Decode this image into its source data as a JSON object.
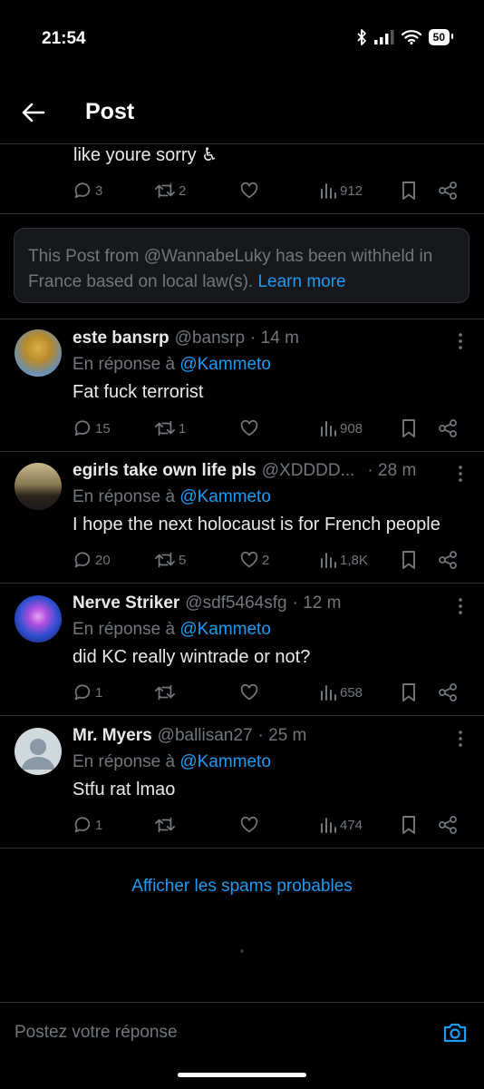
{
  "status_bar": {
    "time": "21:54",
    "battery": "50"
  },
  "header": {
    "title": "Post"
  },
  "previous_post": {
    "text_tail": "like youre sorry ♿",
    "replies": "3",
    "reposts": "2",
    "likes": "",
    "views": "912"
  },
  "withheld_notice": {
    "text": "This Post from @WannabeLuky has been withheld in France based on local law(s).",
    "link": "Learn more"
  },
  "replies": [
    {
      "name": "este bansrp",
      "handle": "@bansrp",
      "time": "· 14 m",
      "reply_prefix": "En réponse à",
      "reply_to": "@Kammeto",
      "text": "Fat fuck terrorist",
      "replies": "15",
      "reposts": "1",
      "likes": "",
      "views": "908"
    },
    {
      "name": "egirls take own life pls",
      "handle": "@XDDDD...",
      "time": "· 28 m",
      "reply_prefix": "En réponse à",
      "reply_to": "@Kammeto",
      "text": "I hope the next holocaust is for French people",
      "replies": "20",
      "reposts": "5",
      "likes": "2",
      "views": "1,8K"
    },
    {
      "name": "Nerve Striker",
      "handle": "@sdf5464sfg",
      "time": "· 12 m",
      "reply_prefix": "En réponse à",
      "reply_to": "@Kammeto",
      "text": "did KC really wintrade or not?",
      "replies": "1",
      "reposts": "",
      "likes": "",
      "views": "658"
    },
    {
      "name": "Mr. Myers",
      "handle": "@ballisan27",
      "time": "· 25 m",
      "reply_prefix": "En réponse à",
      "reply_to": "@Kammeto",
      "text": "Stfu rat lmao",
      "replies": "1",
      "reposts": "",
      "likes": "",
      "views": "474"
    }
  ],
  "show_spam_label": "Afficher les spams probables",
  "composer": {
    "placeholder": "Postez votre réponse"
  },
  "colors": {
    "background": "#000000",
    "text": "#e7e9ea",
    "muted": "#71767b",
    "accent": "#1d9bf0",
    "divider": "#2f3336"
  }
}
